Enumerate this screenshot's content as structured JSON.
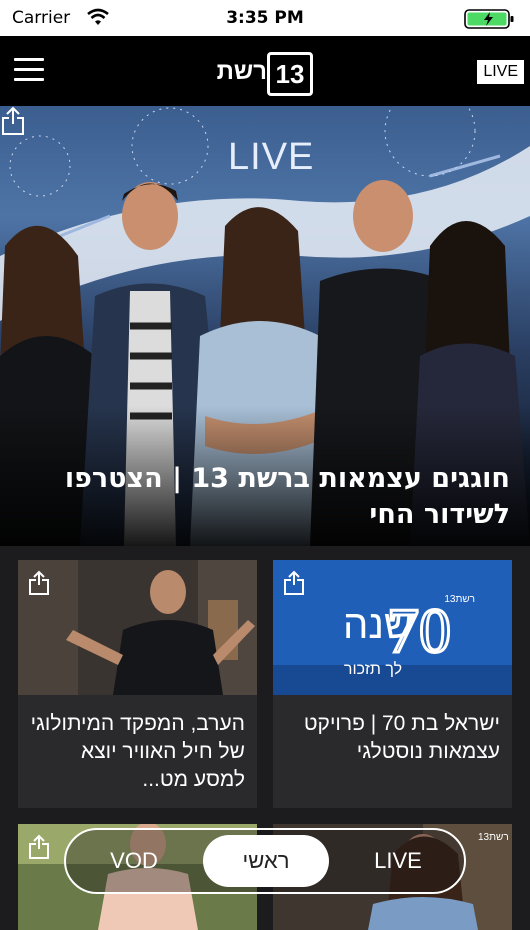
{
  "status_bar": {
    "carrier": "Carrier",
    "time": "3:35 PM"
  },
  "header": {
    "logo_text": "רשת",
    "logo_number": "13",
    "live_label": "LIVE"
  },
  "hero": {
    "overlay_label": "LIVE",
    "title": "חוגגים עצמאות ברשת 13 | הצטרפו לשידור החי"
  },
  "cards": [
    {
      "title": "ישראל בת 70 | פרויקט עצמאות נוסטלגי",
      "image_text": "שנה",
      "image_number": "70",
      "image_subtitle": "לך תזכור",
      "image_brand": "רשת13"
    },
    {
      "title": "הערב, המפקד המיתולוגי של חיל האוויר יוצא למסע מט..."
    },
    {
      "title": ""
    },
    {
      "title": "",
      "image_brand": "רשת13"
    }
  ],
  "tabs": {
    "vod": "VOD",
    "main": "ראשי",
    "live": "LIVE"
  },
  "colors": {
    "battery_green": "#4cd964",
    "nav_background": "#000000",
    "card_background": "#2a2a2c",
    "promo_blue": "#1f5fb8"
  }
}
